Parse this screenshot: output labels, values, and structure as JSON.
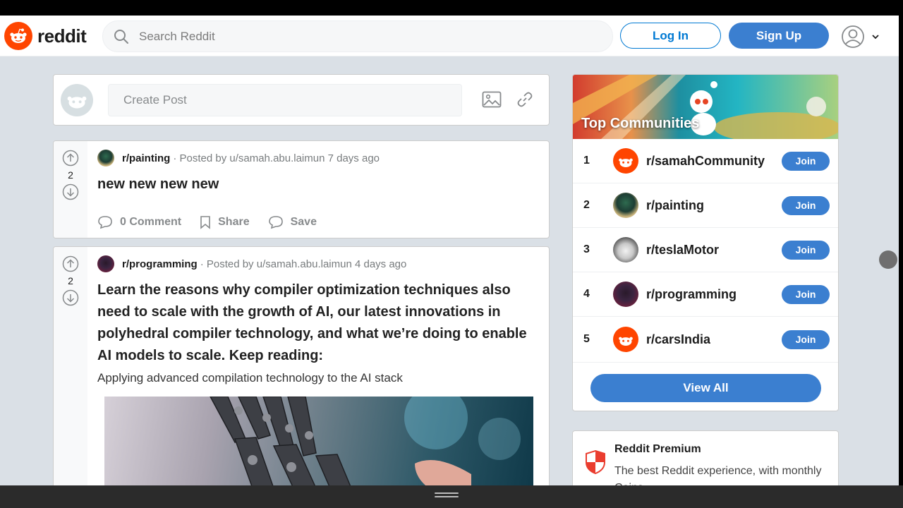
{
  "header": {
    "logo_text": "reddit",
    "search_placeholder": "Search Reddit",
    "login_label": "Log In",
    "signup_label": "Sign Up"
  },
  "create_post": {
    "placeholder": "Create Post"
  },
  "posts": [
    {
      "votes": "2",
      "subreddit": "r/painting",
      "meta": "· Posted by u/samah.abu.laimun 7 days ago",
      "title": "new new new new",
      "actions": {
        "comment": "0 Comment",
        "share": "Share",
        "save": "Save"
      }
    },
    {
      "votes": "2",
      "subreddit": "r/programming",
      "meta": "· Posted by u/samah.abu.laimun 4 days ago",
      "title": "Learn the reasons why compiler optimization techniques also need to scale with the growth of AI, our latest innovations in polyhedral compiler technology, and what we’re doing to enable AI models to scale. Keep reading:",
      "subtitle": "Applying advanced compilation technology to the AI stack"
    }
  ],
  "top_communities": {
    "title": "Top Communities",
    "items": [
      {
        "rank": "1",
        "name": "r/samahCommunity",
        "join": "Join"
      },
      {
        "rank": "2",
        "name": "r/painting",
        "join": "Join"
      },
      {
        "rank": "3",
        "name": "r/teslaMotor",
        "join": "Join"
      },
      {
        "rank": "4",
        "name": "r/programming",
        "join": "Join"
      },
      {
        "rank": "5",
        "name": "r/carsIndia",
        "join": "Join"
      }
    ],
    "view_all": "View All"
  },
  "premium": {
    "title": "Reddit Premium",
    "description": "The best Reddit experience, with monthly Coins"
  },
  "colors": {
    "brand": "#ff4500",
    "accent": "#0079d3",
    "background": "#dae0e6"
  }
}
